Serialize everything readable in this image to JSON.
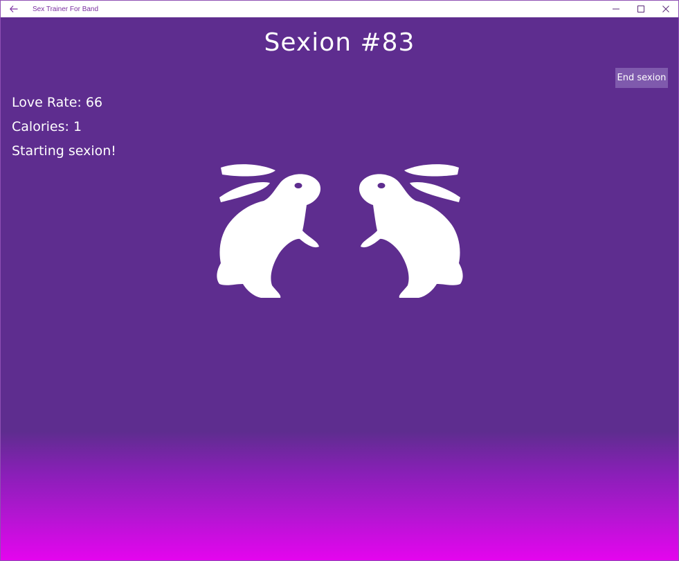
{
  "window": {
    "app_title": "Sex Trainer For Band",
    "back_icon": "arrow-left-icon",
    "controls": [
      "minimize-icon",
      "maximize-icon",
      "close-icon"
    ]
  },
  "session": {
    "title": "Sexion #83",
    "end_button_label": "End sexion",
    "love_rate_label": "Love Rate:",
    "love_rate_value": "66",
    "calories_label": "Calories:",
    "calories_value": "1",
    "status": "Starting sexion!"
  },
  "illustration": {
    "icon": "bunnies-icon",
    "color": "#ffffff"
  },
  "colors": {
    "background_top": "#5e2d8f",
    "background_bottom": "#e405ee",
    "button": "#7f5aad",
    "title_text": "#7a2fa0"
  }
}
